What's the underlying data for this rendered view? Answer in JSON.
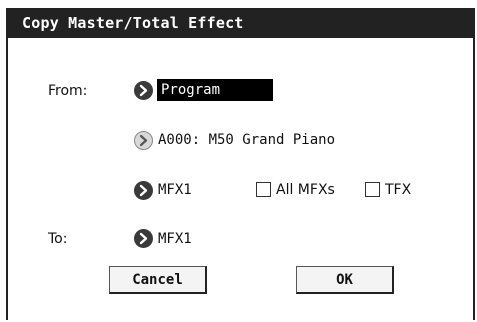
{
  "dialog": {
    "title": "Copy Master/Total Effect",
    "from_label": "From:",
    "to_label": "To:",
    "from_source_value": "Program",
    "from_program_value": "A000: M50 Grand Piano",
    "from_effect_value": "MFX1",
    "all_mfxs_label": "All MFXs",
    "all_mfxs_checked": false,
    "tfx_label": "TFX",
    "tfx_checked": false,
    "to_effect_value": "MFX1",
    "cancel_label": "Cancel",
    "ok_label": "OK"
  },
  "icons": {
    "popup": "chevron-right-circle-icon"
  },
  "colors": {
    "titlebar_bg": "#222222",
    "selected_bg": "#000000"
  }
}
